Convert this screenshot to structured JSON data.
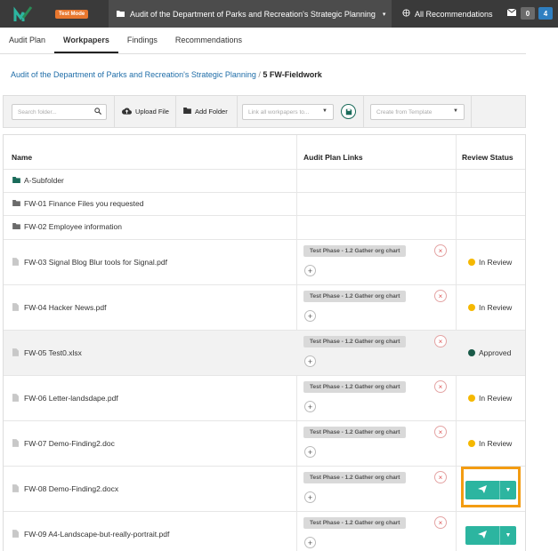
{
  "topbar": {
    "test_mode": "Test Mode",
    "project_title": "Audit of the Department of Parks and Recreation's Strategic Planning",
    "all_recommendations": "All Recommendations",
    "badge_messages": "0",
    "badge_notifications": "4"
  },
  "tabs": [
    {
      "label": "Audit Plan"
    },
    {
      "label": "Workpapers"
    },
    {
      "label": "Findings"
    },
    {
      "label": "Recommendations"
    }
  ],
  "breadcrumb": {
    "parent": "Audit of the Department of Parks and Recreation's Strategic Planning",
    "separator": "/",
    "current": "5 FW-Fieldwork"
  },
  "toolbar": {
    "search_placeholder": "Search folder...",
    "upload_file": "Upload File",
    "add_folder": "Add Folder",
    "link_placeholder": "Link all workpapers to...",
    "template_placeholder": "Create from Template"
  },
  "table": {
    "headers": {
      "name": "Name",
      "links": "Audit Plan Links",
      "status": "Review Status"
    },
    "rows": [
      {
        "name": "A-Subfolder",
        "type": "folder-green",
        "link": "",
        "status": "",
        "status_color": ""
      },
      {
        "name": "FW-01 Finance Files you requested",
        "type": "folder",
        "link": "",
        "status": "",
        "status_color": ""
      },
      {
        "name": "FW-02 Employee information",
        "type": "folder",
        "link": "",
        "status": "",
        "status_color": ""
      },
      {
        "name": "FW-03 Signal Blog Blur tools for Signal.pdf",
        "type": "file",
        "link": "Test Phase - 1.2 Gather org chart",
        "status": "In Review",
        "status_color": "#f5b800"
      },
      {
        "name": "FW-04 Hacker News.pdf",
        "type": "file",
        "link": "Test Phase - 1.2 Gather org chart",
        "status": "In Review",
        "status_color": "#f5b800"
      },
      {
        "name": "FW-05 Test0.xlsx",
        "type": "file",
        "link": "Test Phase - 1.2 Gather org chart",
        "status": "Approved",
        "status_color": "#1a5a48"
      },
      {
        "name": "FW-06 Letter-landsdape.pdf",
        "type": "file",
        "link": "Test Phase - 1.2 Gather org chart",
        "status": "In Review",
        "status_color": "#f5b800"
      },
      {
        "name": "FW-07 Demo-Finding2.doc",
        "type": "file",
        "link": "Test Phase - 1.2 Gather org chart",
        "status": "In Review",
        "status_color": "#f5b800"
      },
      {
        "name": "FW-08 Demo-Finding2.docx",
        "type": "file",
        "link": "Test Phase - 1.2 Gather org chart",
        "status": "",
        "status_color": ""
      },
      {
        "name": "FW-09 A4-Landscape-but-really-portrait.pdf",
        "type": "file",
        "link": "Test Phase - 1.2 Gather org chart",
        "status": "",
        "status_color": ""
      }
    ]
  },
  "colors": {
    "accent": "#2cb5a0",
    "highlight": "#f39c12",
    "in_review": "#f5b800",
    "approved": "#1a5a48"
  }
}
